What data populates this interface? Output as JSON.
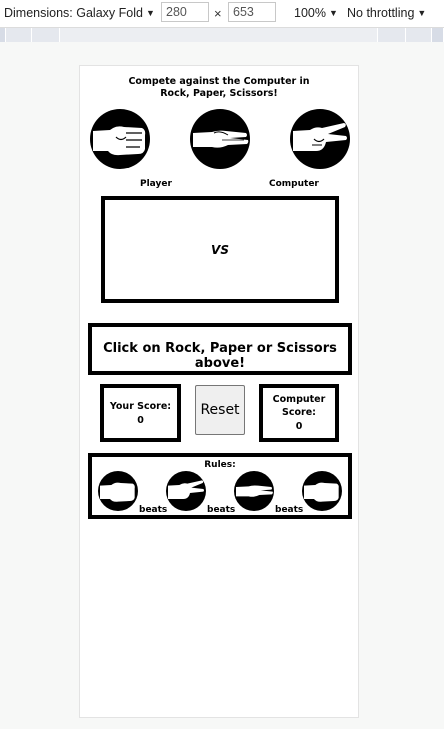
{
  "toolbar": {
    "dimensions_label": "Dimensions: Galaxy Fold",
    "width_value": "280",
    "height_value": "653",
    "times_symbol": "×",
    "zoom_label": "100%",
    "throttling_label": "No throttling"
  },
  "game": {
    "title_line1": "Compete against the Computer in",
    "title_line2": "Rock, Paper, Scissors!",
    "choices": [
      {
        "name": "rock",
        "icon": "rock-hand-icon"
      },
      {
        "name": "paper",
        "icon": "paper-hand-icon"
      },
      {
        "name": "scissors",
        "icon": "scissors-hand-icon"
      }
    ],
    "player_label": "Player",
    "computer_label": "Computer",
    "vs_text": "VS",
    "message": "Click on Rock, Paper or Scissors above!",
    "your_score_label": "Your Score:",
    "your_score_value": "0",
    "computer_score_label_line1": "Computer",
    "computer_score_label_line2": "Score:",
    "computer_score_value": "0",
    "reset_label": "Reset",
    "rules_title": "Rules:",
    "beats_word": "beats"
  },
  "colors": {
    "border": "#000000",
    "background": "#f7f8f7",
    "viewport": "#ffffff"
  }
}
